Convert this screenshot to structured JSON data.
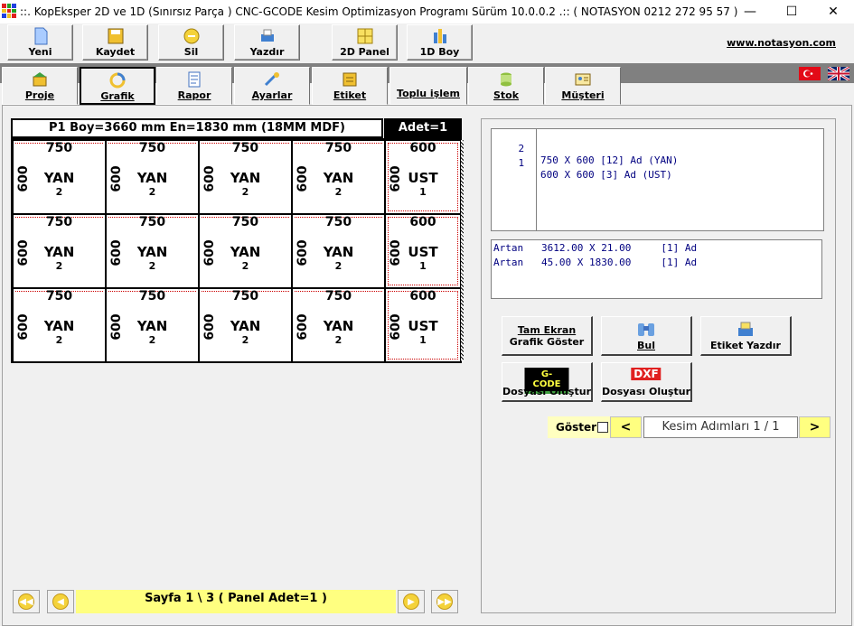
{
  "window": {
    "title": "::. KopEksper 2D ve 1D (Sınırsız Parça )  CNC-GCODE  Kesim Optimizasyon Programı Sürüm 10.0.0.2 .::  ( NOTASYON 0212 272 95 57 )",
    "minimize": "—",
    "maximize": "☐",
    "close": "✕"
  },
  "toolbar": {
    "buttons": [
      {
        "label": "Yeni"
      },
      {
        "label": "Kaydet"
      },
      {
        "label": "Sil"
      },
      {
        "label": "Yazdır"
      },
      {
        "label": "2D Panel"
      },
      {
        "label": "1D Boy"
      }
    ],
    "site": "www.notasyon.com"
  },
  "tabs": [
    {
      "label": "Proje"
    },
    {
      "label": "Grafik"
    },
    {
      "label": "Rapor"
    },
    {
      "label": "Ayarlar"
    },
    {
      "label": "Etiket"
    },
    {
      "label": "Toplu işlem"
    },
    {
      "label": "Stok"
    },
    {
      "label": "Müşteri"
    }
  ],
  "plan": {
    "header": "P1  Boy=3660 mm  En=1830 mm (18MM MDF)",
    "adet": "Adet=1",
    "rows": [
      [
        {
          "w": "750",
          "h": "600",
          "name": "YAN",
          "qty": "2"
        },
        {
          "w": "750",
          "h": "600",
          "name": "YAN",
          "qty": "2"
        },
        {
          "w": "750",
          "h": "600",
          "name": "YAN",
          "qty": "2"
        },
        {
          "w": "750",
          "h": "600",
          "name": "YAN",
          "qty": "2"
        },
        {
          "w": "600",
          "h": "600",
          "name": "UST",
          "qty": "1"
        }
      ],
      [
        {
          "w": "750",
          "h": "600",
          "name": "YAN",
          "qty": "2"
        },
        {
          "w": "750",
          "h": "600",
          "name": "YAN",
          "qty": "2"
        },
        {
          "w": "750",
          "h": "600",
          "name": "YAN",
          "qty": "2"
        },
        {
          "w": "750",
          "h": "600",
          "name": "YAN",
          "qty": "2"
        },
        {
          "w": "600",
          "h": "600",
          "name": "UST",
          "qty": "1"
        }
      ],
      [
        {
          "w": "750",
          "h": "600",
          "name": "YAN",
          "qty": "2"
        },
        {
          "w": "750",
          "h": "600",
          "name": "YAN",
          "qty": "2"
        },
        {
          "w": "750",
          "h": "600",
          "name": "YAN",
          "qty": "2"
        },
        {
          "w": "750",
          "h": "600",
          "name": "YAN",
          "qty": "2"
        },
        {
          "w": "600",
          "h": "600",
          "name": "UST",
          "qty": "1"
        }
      ]
    ]
  },
  "pagination": {
    "label": "Sayfa 1 \\ 3   ( Panel  Adet=1 )"
  },
  "parts_list": [
    {
      "no": "2",
      "desc": "750 X 600 [12] Ad (YAN)"
    },
    {
      "no": "1",
      "desc": "600 X 600 [3] Ad (UST)"
    }
  ],
  "leftovers": [
    "Artan   3612.00 X 21.00     [1] Ad",
    "Artan   45.00 X 1830.00     [1] Ad"
  ],
  "actions": {
    "fullscreen_line1": "Tam Ekran",
    "fullscreen_line2": "Grafik Göster",
    "find": "Bul",
    "print_label": "Etiket Yazdır",
    "gcode_badge": "G-CODE",
    "gcode": "Dosyası Oluştur",
    "dxf_badge": "DXF",
    "dxf": "Dosyası Oluştur"
  },
  "steps": {
    "show_label": "Göster",
    "prev": "<",
    "next": ">",
    "text": "Kesim Adımları 1 / 1"
  }
}
